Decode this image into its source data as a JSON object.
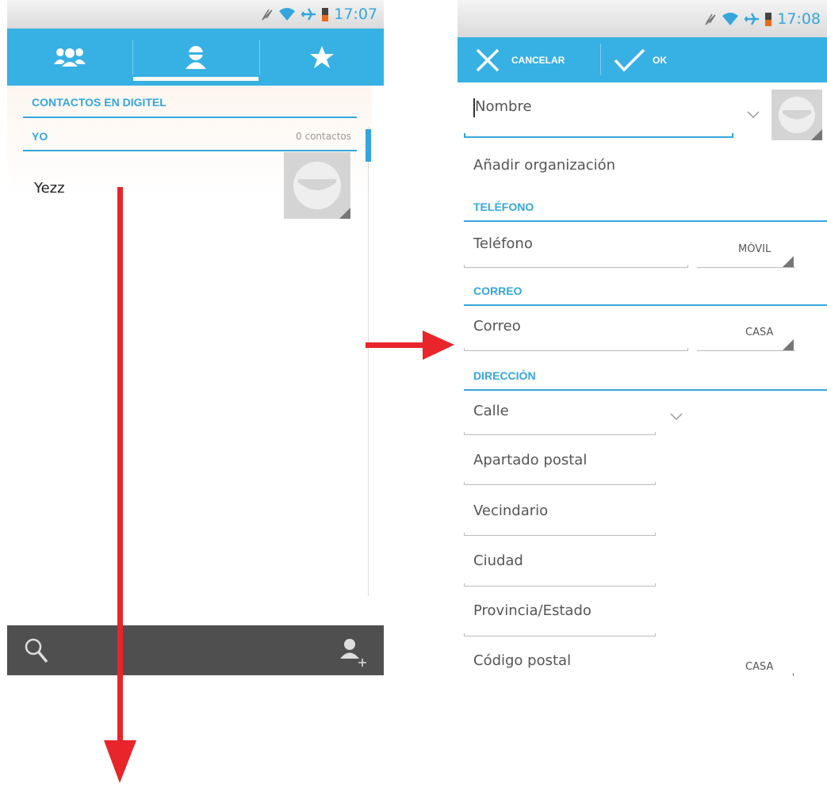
{
  "left_screen": {
    "status": {
      "time": "17:07"
    },
    "tabs": [
      {
        "name": "groups",
        "icon": "groups-icon"
      },
      {
        "name": "contacts",
        "icon": "person-icon"
      },
      {
        "name": "favorites",
        "icon": "star-icon"
      }
    ],
    "account_header": "CONTACTOS EN DIGITEL",
    "group": {
      "label": "YO",
      "count": "0 contactos"
    },
    "contact": {
      "name": "Yezz"
    },
    "bottom_bar": {
      "search_icon": "search-icon",
      "add_icon": "add-contact-icon"
    }
  },
  "right_screen": {
    "status": {
      "time": "17:08"
    },
    "action_bar": {
      "cancel_label": "CANCELAR",
      "ok_label": "OK"
    },
    "name_placeholder": "Nombre",
    "add_org": "Añadir organización",
    "phone": {
      "header": "TELÉFONO",
      "placeholder": "Teléfono",
      "type": "MÓVIL"
    },
    "email": {
      "header": "CORREO",
      "placeholder": "Correo",
      "type": "CASA"
    },
    "address": {
      "header": "DIRECCIÓN",
      "street": "Calle",
      "po_box": "Apartado postal",
      "neighborhood": "Vecindario",
      "city": "Ciudad",
      "state": "Provincia/Estado",
      "postal_code": "Código postal",
      "type": "CASA"
    }
  },
  "colors": {
    "accent": "#37b0e3",
    "annotation_arrow": "#e8252a",
    "bottom_bar": "#4f4f4f"
  }
}
